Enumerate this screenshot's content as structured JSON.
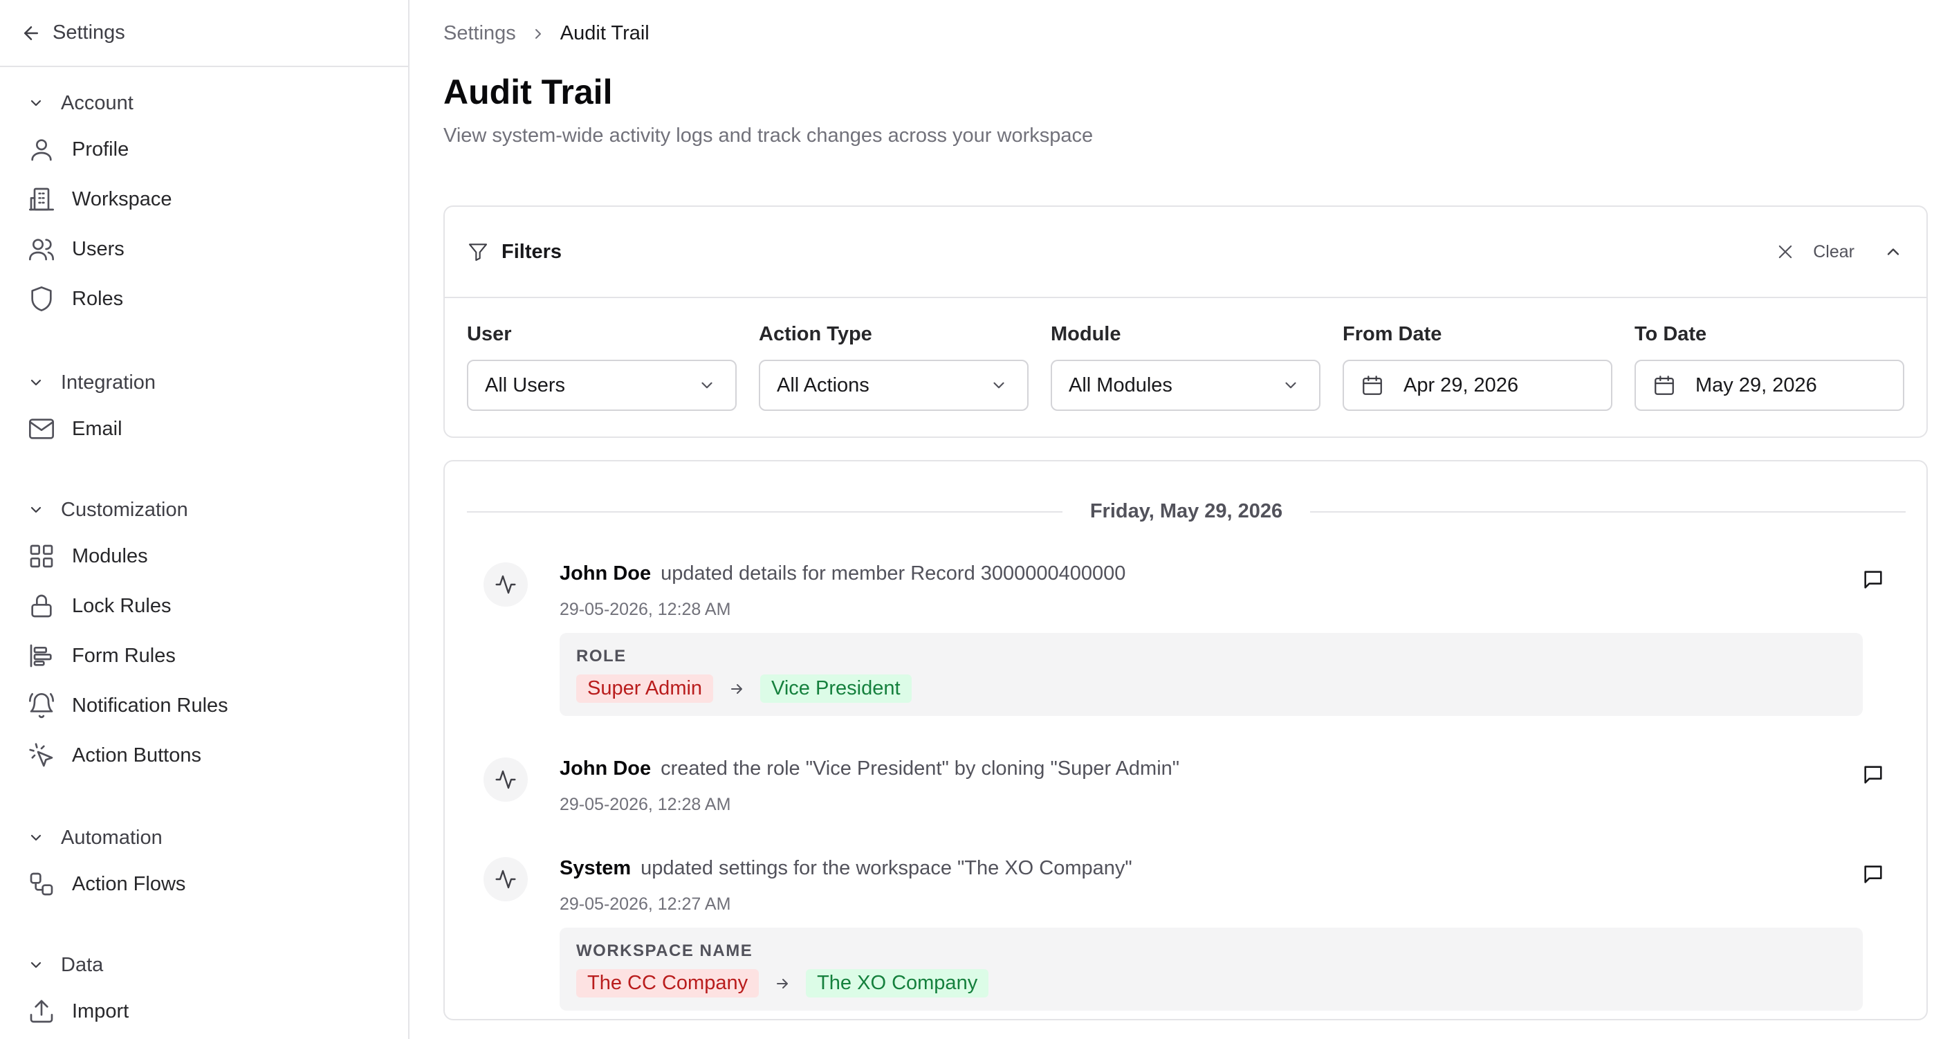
{
  "sidebar": {
    "back_label": "Settings",
    "groups": [
      {
        "label": "Account",
        "items": [
          "Profile",
          "Workspace",
          "Users",
          "Roles"
        ]
      },
      {
        "label": "Integration",
        "items": [
          "Email"
        ]
      },
      {
        "label": "Customization",
        "items": [
          "Modules",
          "Lock Rules",
          "Form Rules",
          "Notification Rules",
          "Action Buttons"
        ]
      },
      {
        "label": "Automation",
        "items": [
          "Action Flows"
        ]
      },
      {
        "label": "Data",
        "items": [
          "Import"
        ]
      }
    ]
  },
  "breadcrumb": {
    "parent": "Settings",
    "current": "Audit Trail"
  },
  "page": {
    "title": "Audit Trail",
    "description": "View system-wide activity logs and track changes across your workspace"
  },
  "filters": {
    "title": "Filters",
    "clear_label": "Clear",
    "fields": {
      "user": {
        "label": "User",
        "value": "All Users"
      },
      "action_type": {
        "label": "Action Type",
        "value": "All Actions"
      },
      "module": {
        "label": "Module",
        "value": "All Modules"
      },
      "from_date": {
        "label": "From Date",
        "value": "Apr 29, 2026"
      },
      "to_date": {
        "label": "To Date",
        "value": "May 29, 2026"
      }
    }
  },
  "log": {
    "date_header": "Friday, May 29, 2026",
    "entries": [
      {
        "actor": "John Doe",
        "message": "updated details for member Record 3000000400000",
        "timestamp": "29-05-2026, 12:28 AM",
        "change": {
          "field": "ROLE",
          "old": "Super Admin",
          "new": "Vice President"
        }
      },
      {
        "actor": "John Doe",
        "message": "created the role \"Vice President\" by cloning \"Super Admin\"",
        "timestamp": "29-05-2026, 12:28 AM"
      },
      {
        "actor": "System",
        "message": "updated settings for the workspace \"The XO Company\"",
        "timestamp": "29-05-2026, 12:27 AM",
        "change": {
          "field": "WORKSPACE NAME",
          "old": "The CC Company",
          "new": "The XO Company"
        }
      }
    ]
  },
  "colors": {
    "border": "#e4e4e7",
    "old_value_bg": "#fde2e2",
    "old_value_text": "#b91c1c",
    "new_value_bg": "#dcfce7",
    "new_value_text": "#15803d"
  }
}
